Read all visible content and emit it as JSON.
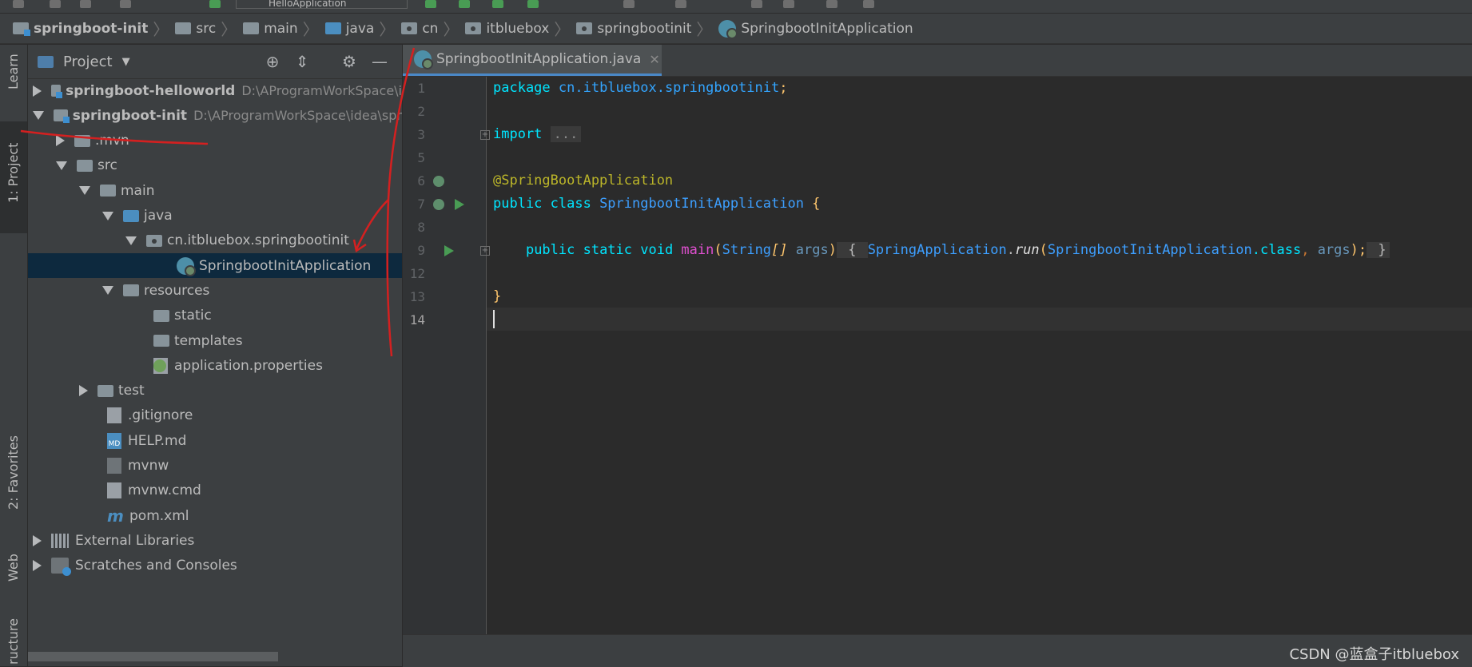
{
  "toolbar": {
    "run_config": "HelloApplication"
  },
  "breadcrumb": [
    {
      "label": "springboot-init",
      "icon": "module-folder-icon",
      "bold": true
    },
    {
      "label": "src",
      "icon": "folder-icon"
    },
    {
      "label": "main",
      "icon": "folder-icon"
    },
    {
      "label": "java",
      "icon": "source-folder-icon"
    },
    {
      "label": "cn",
      "icon": "package-icon"
    },
    {
      "label": "itbluebox",
      "icon": "package-icon"
    },
    {
      "label": "springbootinit",
      "icon": "package-icon"
    },
    {
      "label": "SpringbootInitApplication",
      "icon": "spring-class-icon"
    }
  ],
  "side_tabs": {
    "learn": "Learn",
    "project": "1: Project",
    "favorites": "2: Favorites",
    "web": "Web",
    "structure": "ructure"
  },
  "project_panel": {
    "title": "Project",
    "tree": [
      {
        "label": "springboot-helloworld",
        "path": "D:\\AProgramWorkSpace\\i",
        "arrow": "right",
        "indent": 0,
        "icon": "module",
        "bold": true
      },
      {
        "label": "springboot-init",
        "path": "D:\\AProgramWorkSpace\\idea\\spr",
        "arrow": "down",
        "indent": 0,
        "icon": "module",
        "bold": true
      },
      {
        "label": ".mvn",
        "arrow": "right",
        "indent": 1,
        "icon": "folder"
      },
      {
        "label": "src",
        "arrow": "down",
        "indent": 1,
        "icon": "folder"
      },
      {
        "label": "main",
        "arrow": "down",
        "indent": 2,
        "icon": "folder"
      },
      {
        "label": "java",
        "arrow": "down",
        "indent": 3,
        "icon": "source"
      },
      {
        "label": "cn.itbluebox.springbootinit",
        "arrow": "down",
        "indent": 4,
        "icon": "package"
      },
      {
        "label": "SpringbootInitApplication",
        "arrow": "none",
        "indent": 5,
        "icon": "spring",
        "selected": true
      },
      {
        "label": "resources",
        "arrow": "down",
        "indent": 3,
        "icon": "folder"
      },
      {
        "label": "static",
        "arrow": "none",
        "indent": 4,
        "icon": "folder"
      },
      {
        "label": "templates",
        "arrow": "none",
        "indent": 4,
        "icon": "folder"
      },
      {
        "label": "application.properties",
        "arrow": "none",
        "indent": 4,
        "icon": "props"
      },
      {
        "label": "test",
        "arrow": "right",
        "indent": 2,
        "icon": "folder"
      },
      {
        "label": ".gitignore",
        "arrow": "none",
        "indent": 2,
        "icon": "file"
      },
      {
        "label": "HELP.md",
        "arrow": "none",
        "indent": 2,
        "icon": "md"
      },
      {
        "label": "mvnw",
        "arrow": "none",
        "indent": 2,
        "icon": "term"
      },
      {
        "label": "mvnw.cmd",
        "arrow": "none",
        "indent": 2,
        "icon": "file"
      },
      {
        "label": "pom.xml",
        "arrow": "none",
        "indent": 2,
        "icon": "maven"
      },
      {
        "label": "External Libraries",
        "arrow": "right",
        "indent": 0,
        "icon": "lib"
      },
      {
        "label": "Scratches and Consoles",
        "arrow": "right",
        "indent": 0,
        "icon": "scratch"
      }
    ]
  },
  "editor": {
    "tab_label": "SpringbootInitApplication.java",
    "line_numbers": [
      "1",
      "2",
      "3",
      "5",
      "6",
      "7",
      "8",
      "9",
      "12",
      "13",
      "14"
    ],
    "code": {
      "l1_kw": "package",
      "l1_pkg": " cn.itbluebox.springbootinit",
      "l1_semi": ";",
      "l3_kw": "import",
      "l3_fold": "...",
      "l6_ann": "@SpringBootApplication",
      "l7_kw": "public class",
      "l7_cls": " SpringbootInitApplication",
      "l7_brace": " {",
      "l9_indent": "    ",
      "l9_kw": "public static void",
      "l9_meth": " main",
      "l9_p1": "(",
      "l9_type": "String",
      "l9_arr": "[]",
      "l9_args": " args",
      "l9_p2": ")",
      "l9_ob": " { ",
      "l9_sa": "SpringApplication",
      "l9_dot": ".",
      "l9_run": "run",
      "l9_p3": "(",
      "l9_sia": "SpringbootInitApplication",
      "l9_dotclass": ".class",
      "l9_comma": ",",
      "l9_args2": " args",
      "l9_end": ");",
      "l9_cb": " }",
      "l13_brace": "}"
    }
  },
  "watermark": "CSDN @蓝盒子itbluebox"
}
